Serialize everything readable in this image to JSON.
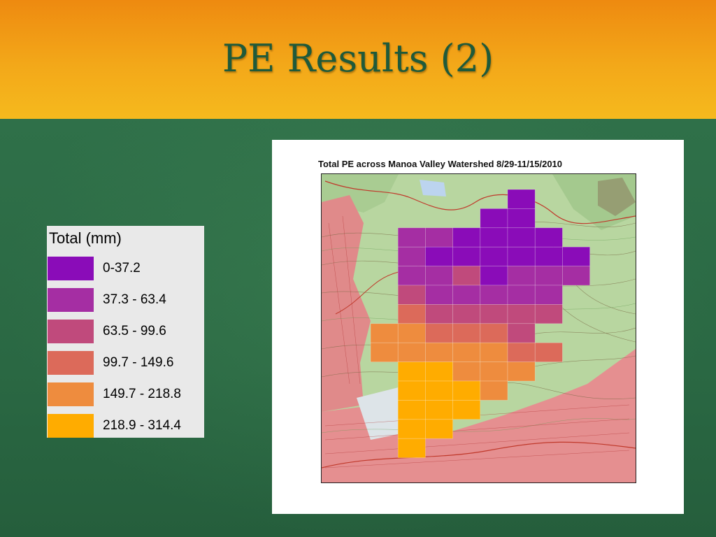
{
  "slide": {
    "title": "PE Results (2)",
    "colors": {
      "header_orange": "#f0a818",
      "body_green": "#2e6e47",
      "title_green": "#1f5a3a"
    }
  },
  "legend": {
    "title": "Total (mm)",
    "classes": [
      {
        "label": "0-37.2",
        "color": "#8a0cb8"
      },
      {
        "label": "37.3 - 63.4",
        "color": "#a52ea3"
      },
      {
        "label": "63.5 - 99.6",
        "color": "#c04a7c"
      },
      {
        "label": "99.7 - 149.6",
        "color": "#dc6a5a"
      },
      {
        "label": "149.7 - 218.8",
        "color": "#ee8c3e"
      },
      {
        "label": "218.9 - 314.4",
        "color": "#ffac00"
      }
    ]
  },
  "figure": {
    "title": "Total PE across Manoa Valley Watershed 8/29-11/15/2010",
    "basemap": "topographic map of Manoa Valley",
    "grid_cells": [
      {
        "row": 0,
        "col": 5,
        "class": 0
      },
      {
        "row": 1,
        "col": 4,
        "class": 0
      },
      {
        "row": 1,
        "col": 5,
        "class": 0
      },
      {
        "row": 2,
        "col": 1,
        "class": 1
      },
      {
        "row": 2,
        "col": 2,
        "class": 1
      },
      {
        "row": 2,
        "col": 3,
        "class": 0
      },
      {
        "row": 2,
        "col": 4,
        "class": 0
      },
      {
        "row": 2,
        "col": 5,
        "class": 0
      },
      {
        "row": 2,
        "col": 6,
        "class": 0
      },
      {
        "row": 3,
        "col": 1,
        "class": 1
      },
      {
        "row": 3,
        "col": 2,
        "class": 0
      },
      {
        "row": 3,
        "col": 3,
        "class": 0
      },
      {
        "row": 3,
        "col": 4,
        "class": 0
      },
      {
        "row": 3,
        "col": 5,
        "class": 0
      },
      {
        "row": 3,
        "col": 6,
        "class": 0
      },
      {
        "row": 3,
        "col": 7,
        "class": 0
      },
      {
        "row": 4,
        "col": 1,
        "class": 1
      },
      {
        "row": 4,
        "col": 2,
        "class": 1
      },
      {
        "row": 4,
        "col": 3,
        "class": 2
      },
      {
        "row": 4,
        "col": 4,
        "class": 0
      },
      {
        "row": 4,
        "col": 5,
        "class": 1
      },
      {
        "row": 4,
        "col": 6,
        "class": 1
      },
      {
        "row": 4,
        "col": 7,
        "class": 1
      },
      {
        "row": 5,
        "col": 1,
        "class": 2
      },
      {
        "row": 5,
        "col": 2,
        "class": 1
      },
      {
        "row": 5,
        "col": 3,
        "class": 1
      },
      {
        "row": 5,
        "col": 4,
        "class": 1
      },
      {
        "row": 5,
        "col": 5,
        "class": 1
      },
      {
        "row": 5,
        "col": 6,
        "class": 1
      },
      {
        "row": 6,
        "col": 1,
        "class": 3
      },
      {
        "row": 6,
        "col": 2,
        "class": 2
      },
      {
        "row": 6,
        "col": 3,
        "class": 2
      },
      {
        "row": 6,
        "col": 4,
        "class": 2
      },
      {
        "row": 6,
        "col": 5,
        "class": 2
      },
      {
        "row": 6,
        "col": 6,
        "class": 2
      },
      {
        "row": 7,
        "col": 0,
        "class": 4
      },
      {
        "row": 7,
        "col": 1,
        "class": 4
      },
      {
        "row": 7,
        "col": 2,
        "class": 3
      },
      {
        "row": 7,
        "col": 3,
        "class": 3
      },
      {
        "row": 7,
        "col": 4,
        "class": 3
      },
      {
        "row": 7,
        "col": 5,
        "class": 2
      },
      {
        "row": 8,
        "col": 0,
        "class": 4
      },
      {
        "row": 8,
        "col": 1,
        "class": 4
      },
      {
        "row": 8,
        "col": 2,
        "class": 4
      },
      {
        "row": 8,
        "col": 3,
        "class": 4
      },
      {
        "row": 8,
        "col": 4,
        "class": 4
      },
      {
        "row": 8,
        "col": 5,
        "class": 3
      },
      {
        "row": 8,
        "col": 6,
        "class": 3
      },
      {
        "row": 9,
        "col": 1,
        "class": 5
      },
      {
        "row": 9,
        "col": 2,
        "class": 5
      },
      {
        "row": 9,
        "col": 3,
        "class": 4
      },
      {
        "row": 9,
        "col": 4,
        "class": 4
      },
      {
        "row": 9,
        "col": 5,
        "class": 4
      },
      {
        "row": 10,
        "col": 1,
        "class": 5
      },
      {
        "row": 10,
        "col": 2,
        "class": 5
      },
      {
        "row": 10,
        "col": 3,
        "class": 5
      },
      {
        "row": 10,
        "col": 4,
        "class": 4
      },
      {
        "row": 11,
        "col": 1,
        "class": 5
      },
      {
        "row": 11,
        "col": 2,
        "class": 5
      },
      {
        "row": 11,
        "col": 3,
        "class": 5
      },
      {
        "row": 12,
        "col": 1,
        "class": 5
      },
      {
        "row": 12,
        "col": 2,
        "class": 5
      },
      {
        "row": 13,
        "col": 1,
        "class": 5
      }
    ]
  }
}
